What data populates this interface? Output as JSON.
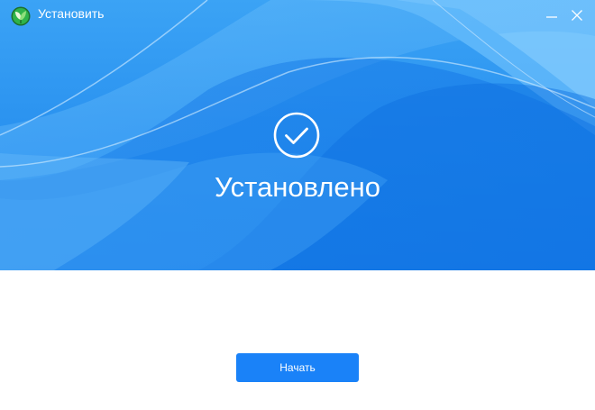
{
  "window": {
    "title": "Установить",
    "logo_icon": "leaf-logo-icon",
    "minimize_icon": "minimize-icon",
    "close_icon": "close-icon"
  },
  "main": {
    "status_icon": "check-circle-icon",
    "status_text": "Установлено",
    "start_button_label": "Начать"
  },
  "colors": {
    "hero_blue": "#2b93f0",
    "button_blue": "#1a82f8",
    "logo_green": "#2fb34a",
    "logo_dark_green": "#1d6e2b"
  }
}
